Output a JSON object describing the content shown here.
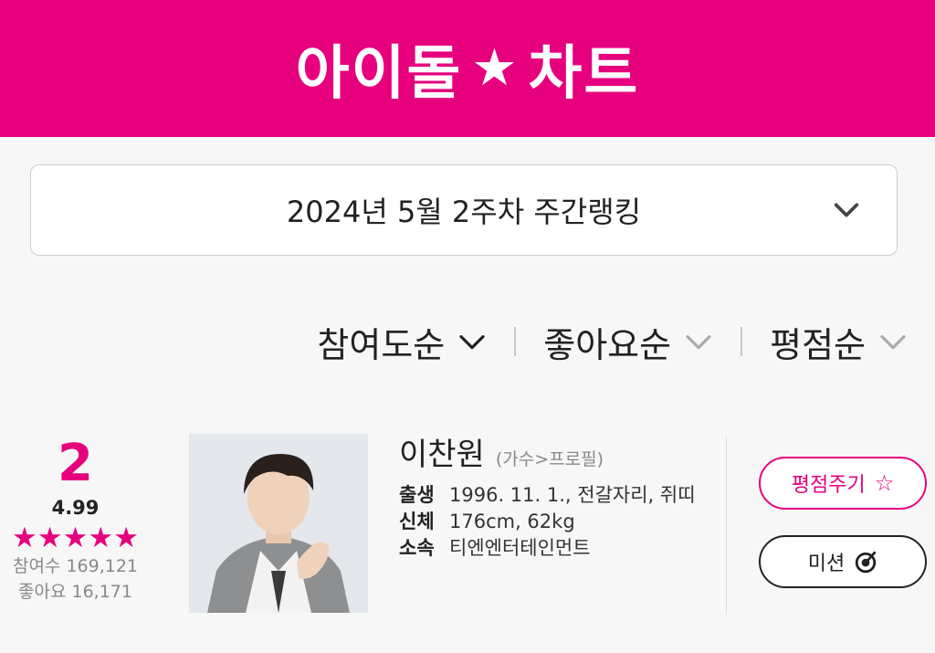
{
  "header": {
    "logo_left": "아이돌",
    "logo_star": "★",
    "logo_right": "차트",
    "bg_color": "#e6007e"
  },
  "week_selector": {
    "label": "2024년 5월 2주차 주간랭킹"
  },
  "sort_tabs": [
    {
      "label": "참여도순",
      "active": true
    },
    {
      "label": "좋아요순",
      "active": false
    },
    {
      "label": "평점순",
      "active": false
    }
  ],
  "ranking": {
    "rank": "2",
    "score": "4.99",
    "stars": 5,
    "participants": "참여수 169,121",
    "likes": "좋아요 16,171",
    "name": "이찬원",
    "profile_link": "(가수>프로필)",
    "details": [
      {
        "key": "출생",
        "value": "1996. 11. 1., 전갈자리, 쥐띠"
      },
      {
        "key": "신체",
        "value": "176cm, 62kg"
      },
      {
        "key": "소속",
        "value": "티엔엔터테인먼트"
      }
    ],
    "rate_button": "평점주기",
    "mission_button": "미션"
  }
}
